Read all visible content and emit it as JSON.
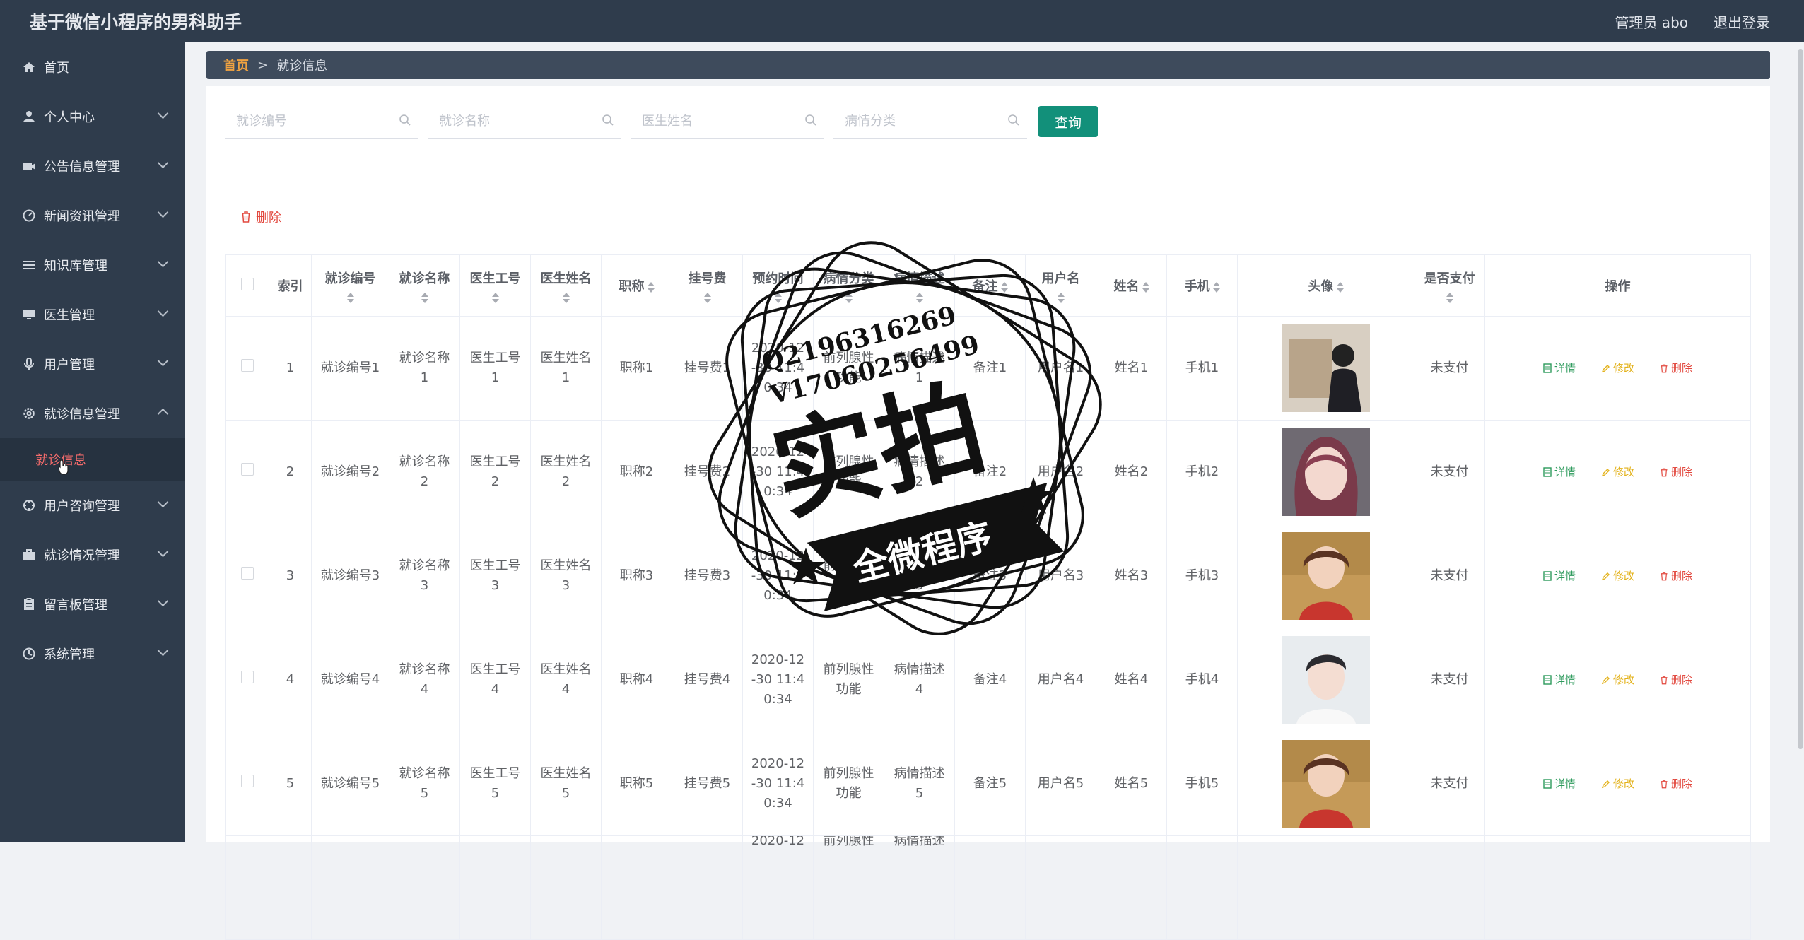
{
  "header": {
    "title": "基于微信小程序的男科助手",
    "admin": "管理员 abo",
    "logout": "退出登录"
  },
  "sidebar": {
    "items": [
      {
        "label": "首页",
        "icon": "home-icon"
      },
      {
        "label": "个人中心",
        "icon": "user-icon"
      },
      {
        "label": "公告信息管理",
        "icon": "camera-icon"
      },
      {
        "label": "新闻资讯管理",
        "icon": "gauge-icon"
      },
      {
        "label": "知识库管理",
        "icon": "list-icon"
      },
      {
        "label": "医生管理",
        "icon": "monitor-icon"
      },
      {
        "label": "用户管理",
        "icon": "microphone-icon"
      },
      {
        "label": "就诊信息管理",
        "icon": "gear-icon"
      },
      {
        "label": "用户咨询管理",
        "icon": "crosshair-icon"
      },
      {
        "label": "就诊情况管理",
        "icon": "briefcase-icon"
      },
      {
        "label": "留言板管理",
        "icon": "clipboard-icon"
      },
      {
        "label": "系统管理",
        "icon": "clock-icon"
      }
    ],
    "active_sub": "就诊信息"
  },
  "breadcrumb": {
    "home": "首页",
    "separator": ">",
    "current": "就诊信息"
  },
  "search": {
    "p1": "就诊编号",
    "p2": "就诊名称",
    "p3": "医生姓名",
    "p4": "病情分类",
    "query": "查询"
  },
  "toolbar": {
    "delete": "删除"
  },
  "table": {
    "headers": [
      "索引",
      "就诊编号",
      "就诊名称",
      "医生工号",
      "医生姓名",
      "职称",
      "挂号费",
      "预约时间",
      "病情分类",
      "病情描述",
      "备注",
      "用户名",
      "姓名",
      "手机",
      "头像",
      "是否支付",
      "操作"
    ],
    "rows": [
      {
        "idx": "1",
        "code": "就诊编号1",
        "name": "就诊名称\n1",
        "docno": "医生工号\n1",
        "docname": "医生姓名\n1",
        "title": "职称1",
        "fee": "挂号费1",
        "time": "2020-12\n-30 11:4\n0:34",
        "cat": "前列腺性\n功能",
        "desc": "病情描述\n1",
        "note": "备注1",
        "user": "用户名1",
        "realname": "姓名1",
        "phone": "手机1",
        "paid": "未支付"
      },
      {
        "idx": "2",
        "code": "就诊编号2",
        "name": "就诊名称\n2",
        "docno": "医生工号\n2",
        "docname": "医生姓名\n2",
        "title": "职称2",
        "fee": "挂号费2",
        "time": "2020-12\n-30 11:4\n0:34",
        "cat": "前列腺性\n功能",
        "desc": "病情描述\n2",
        "note": "备注2",
        "user": "用户名2",
        "realname": "姓名2",
        "phone": "手机2",
        "paid": "未支付"
      },
      {
        "idx": "3",
        "code": "就诊编号3",
        "name": "就诊名称\n3",
        "docno": "医生工号\n3",
        "docname": "医生姓名\n3",
        "title": "职称3",
        "fee": "挂号费3",
        "time": "2020-12\n-30 11:4\n0:34",
        "cat": "前列腺性\n功能",
        "desc": "病情描述\n3",
        "note": "备注3",
        "user": "用户名3",
        "realname": "姓名3",
        "phone": "手机3",
        "paid": "未支付"
      },
      {
        "idx": "4",
        "code": "就诊编号4",
        "name": "就诊名称\n4",
        "docno": "医生工号\n4",
        "docname": "医生姓名\n4",
        "title": "职称4",
        "fee": "挂号费4",
        "time": "2020-12\n-30 11:4\n0:34",
        "cat": "前列腺性\n功能",
        "desc": "病情描述\n4",
        "note": "备注4",
        "user": "用户名4",
        "realname": "姓名4",
        "phone": "手机4",
        "paid": "未支付"
      },
      {
        "idx": "5",
        "code": "就诊编号5",
        "name": "就诊名称\n5",
        "docno": "医生工号\n5",
        "docname": "医生姓名\n5",
        "title": "职称5",
        "fee": "挂号费5",
        "time": "2020-12\n-30 11:4\n0:34",
        "cat": "前列腺性\n功能",
        "desc": "病情描述\n5",
        "note": "备注5",
        "user": "用户名5",
        "realname": "姓名5",
        "phone": "手机5",
        "paid": "未支付"
      }
    ],
    "ops": {
      "detail": "详情",
      "edit": "修改",
      "delete": "删除"
    },
    "partial_row": {
      "cat": "前列腺性",
      "time": "2020-12",
      "desc": "病情描述"
    }
  },
  "watermark": {
    "line1": "Q2196316269",
    "line2": "V17060256499",
    "big": "实拍",
    "banner": "全微程序"
  },
  "colors": {
    "sidebar_bg": "#2f3c4c",
    "accent_green": "#12907a",
    "active_red": "#f26b6b",
    "home_orange": "#f0a341"
  }
}
